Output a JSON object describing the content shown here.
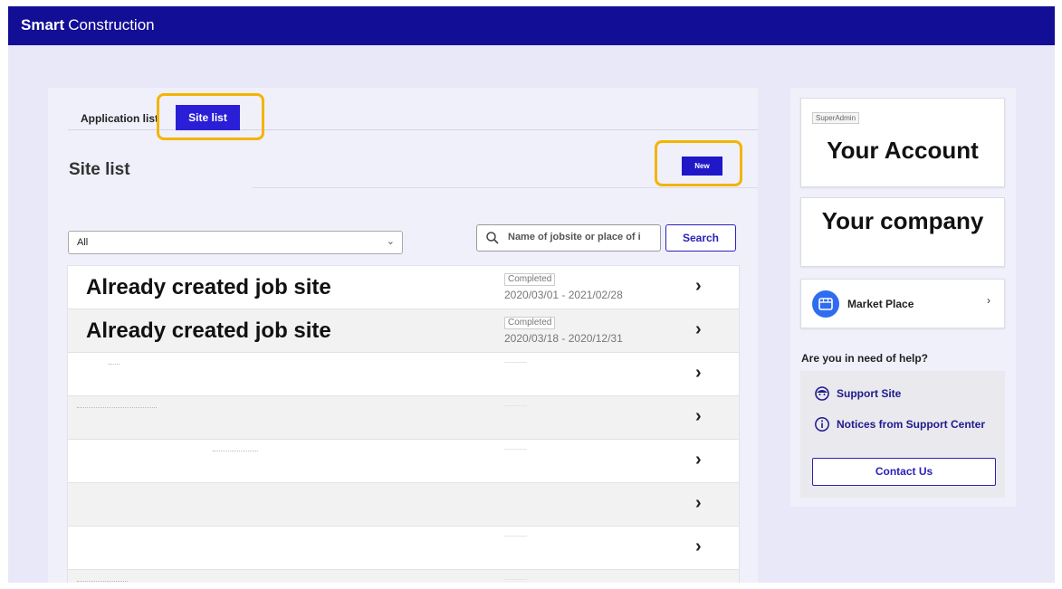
{
  "header": {
    "brand_bold": "Smart",
    "brand_regular": "Construction"
  },
  "tabs": [
    {
      "label": "Application list",
      "active": false
    },
    {
      "label": "Site list",
      "active": true
    }
  ],
  "main": {
    "title": "Site list",
    "new_button": "New",
    "filter": {
      "selected": "All"
    },
    "search": {
      "placeholder": "Name of jobsite or place of i",
      "button": "Search"
    }
  },
  "site_list": [
    {
      "name": "Already created job site",
      "status": "Completed",
      "dates": "2020/03/01 - 2021/02/28"
    },
    {
      "name": "Already created job site",
      "status": "Completed",
      "dates": "2020/03/18 - 2020/12/31"
    },
    {
      "name": "",
      "status": "",
      "dates": ""
    },
    {
      "name": "",
      "status": "",
      "dates": ""
    },
    {
      "name": "",
      "status": "",
      "dates": ""
    },
    {
      "name": "",
      "status": "",
      "dates": ""
    },
    {
      "name": "",
      "status": "",
      "dates": ""
    },
    {
      "name": "",
      "status": "",
      "dates": ""
    }
  ],
  "sidebar": {
    "role_badge": "SuperAdmin",
    "account_name": "Your Account",
    "company_name": "Your company",
    "marketplace_label": "Market Place",
    "help_title": "Are you in need of help?",
    "support_site": "Support Site",
    "notices": "Notices from Support Center",
    "contact": "Contact Us"
  },
  "icons": {
    "search": "search-icon",
    "dropdown": "chevron-down-icon",
    "row_chevron": "chevron-right-icon",
    "marketplace": "store-icon",
    "support": "support-agent-icon",
    "notices": "info-icon"
  },
  "colors": {
    "header_bg": "#120e96",
    "accent": "#2a1ed6",
    "highlight": "#f4b400",
    "link": "#1f1a8a",
    "marketplace_icon_bg": "#2f6cf0"
  }
}
